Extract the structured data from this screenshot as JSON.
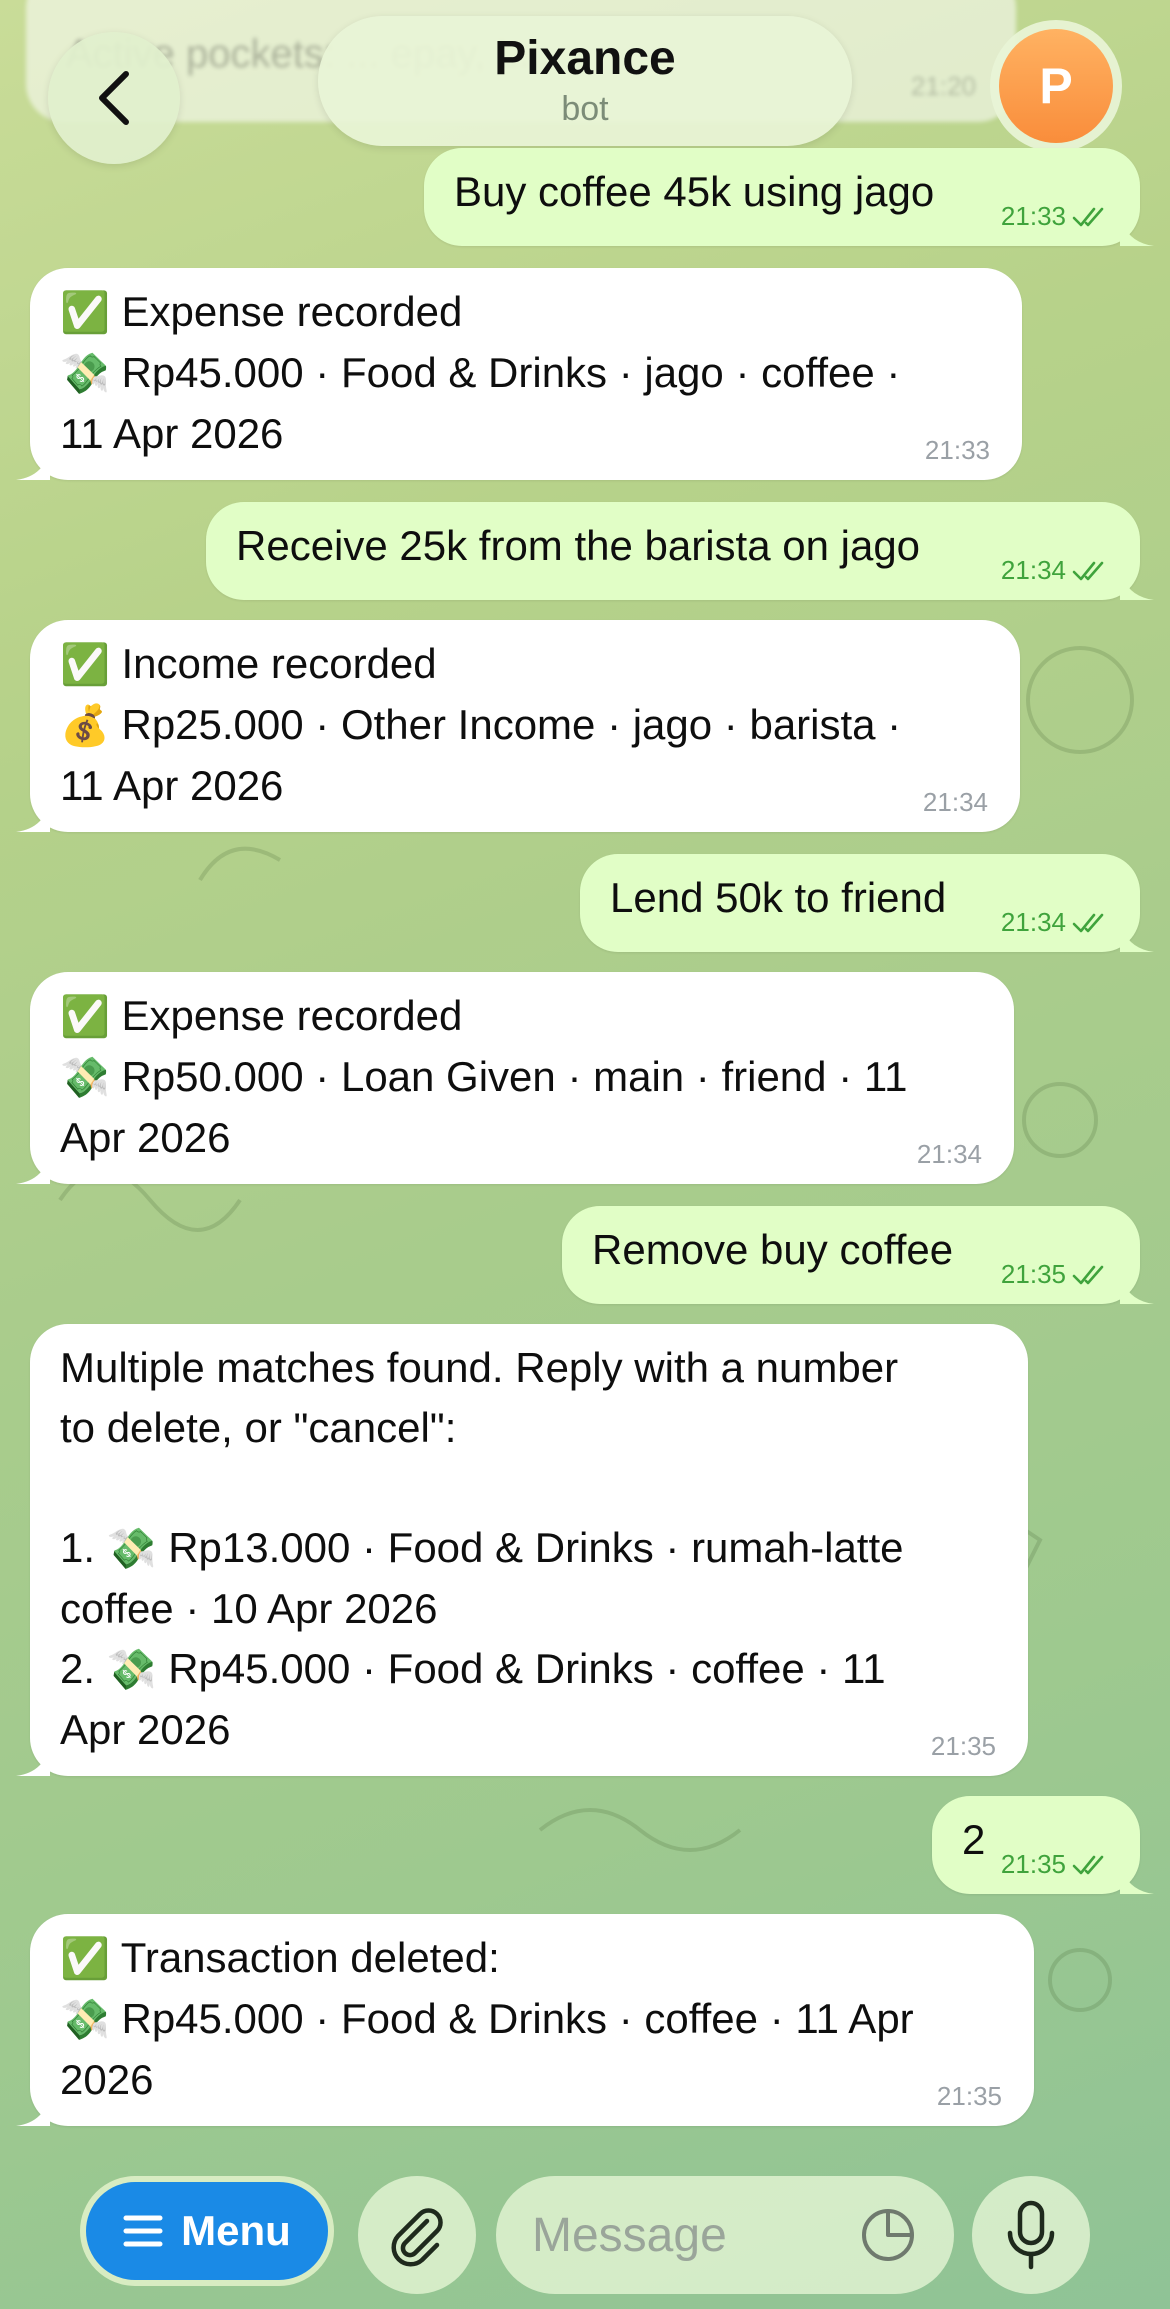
{
  "header": {
    "title": "Pixance",
    "subtitle": "bot",
    "avatar_letter": "P"
  },
  "ghost_message": {
    "text": "Active pockets: ... epay, L...",
    "time": "21:20"
  },
  "messages": [
    {
      "direction": "out",
      "text": "Buy coffee 45k using jago",
      "time": "21:33"
    },
    {
      "direction": "in",
      "emoji1": "✅",
      "line1": "Expense recorded",
      "emoji2": "💸",
      "line2": "Rp45.000 · Food & Drinks · jago · coffee ·\n11 Apr 2026",
      "time": "21:33"
    },
    {
      "direction": "out",
      "text": "Receive 25k from the barista on jago",
      "time": "21:34"
    },
    {
      "direction": "in",
      "emoji1": "✅",
      "line1": "Income recorded",
      "emoji2": "💰",
      "line2": "Rp25.000 · Other Income · jago · barista ·\n11 Apr 2026",
      "time": "21:34"
    },
    {
      "direction": "out",
      "text": "Lend 50k to friend",
      "time": "21:34"
    },
    {
      "direction": "in",
      "emoji1": "✅",
      "line1": "Expense recorded",
      "emoji2": "💸",
      "line2": "Rp50.000 · Loan Given · main · friend · 11\nApr 2026",
      "time": "21:34"
    },
    {
      "direction": "out",
      "text": "Remove buy coffee",
      "time": "21:35"
    },
    {
      "direction": "in",
      "intro": "Multiple matches found. Reply with a number\nto delete, or \"cancel\":",
      "opt1_num": "1.",
      "opt1_emoji": "💸",
      "opt1_text": "Rp13.000 · Food & Drinks · rumah-latte\ncoffee · 10 Apr 2026",
      "opt2_num": "2.",
      "opt2_emoji": "💸",
      "opt2_text": "Rp45.000 · Food & Drinks · coffee · 11\nApr 2026",
      "time": "21:35"
    },
    {
      "direction": "out",
      "text": "2",
      "time": "21:35"
    },
    {
      "direction": "in",
      "emoji1": "✅",
      "line1": "Transaction deleted:",
      "emoji2": "💸",
      "line2": "Rp45.000 · Food & Drinks · coffee · 11 Apr\n2026",
      "time": "21:35"
    }
  ],
  "bottom": {
    "menu_label": "Menu",
    "input_placeholder": "Message"
  },
  "colors": {
    "outgoing_bubble": "#e1fec6",
    "incoming_bubble": "#ffffff",
    "read_check": "#3fa33c",
    "menu_button": "#1a8ae6",
    "avatar": "#f98d3b"
  },
  "icons": [
    "back-chevron-icon",
    "double-check-icon",
    "hamburger-icon",
    "paperclip-icon",
    "sticker-icon",
    "microphone-icon"
  ]
}
